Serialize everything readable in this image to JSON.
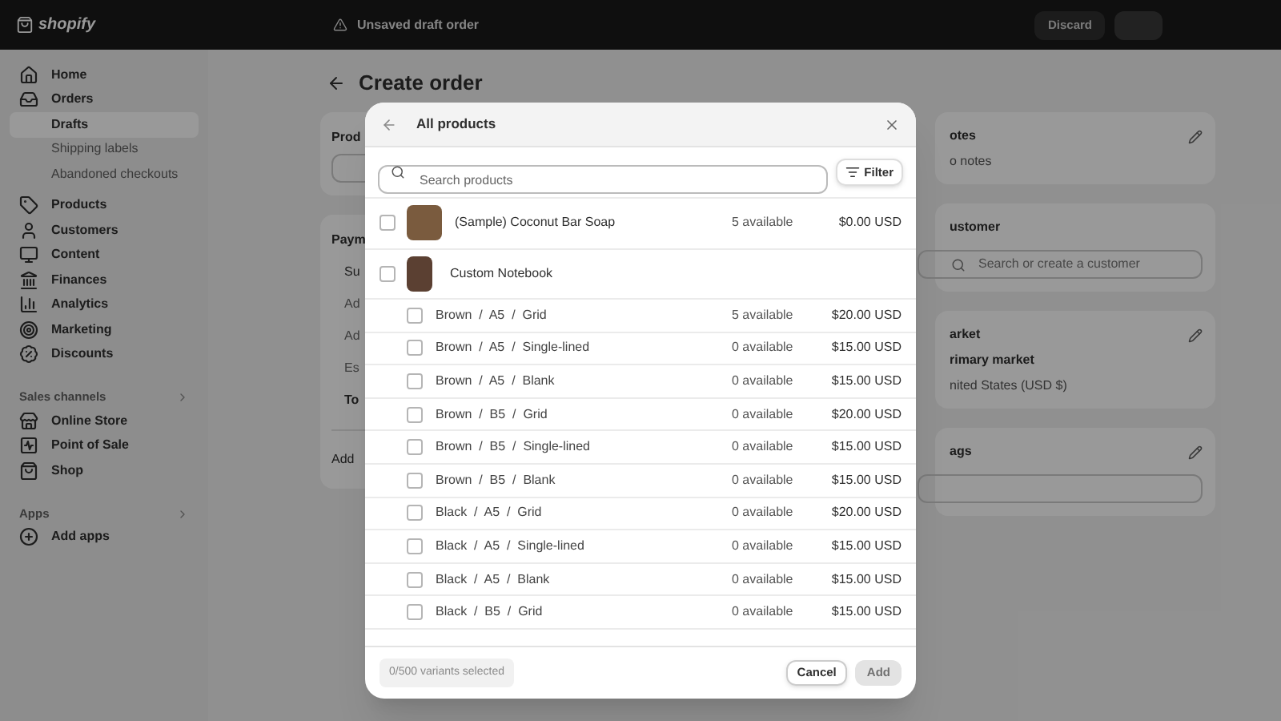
{
  "topbar": {
    "brand": "shopify",
    "notice": "Unsaved draft order",
    "buttons": [
      {
        "label": "Discard",
        "kind": "secondary"
      },
      {
        "kind": "primary"
      }
    ]
  },
  "sidebar": {
    "items": [
      {
        "label": "Home",
        "selected": false
      },
      {
        "label": "Orders",
        "selected": false,
        "children": [
          {
            "label": "Drafts",
            "selected": true
          },
          {
            "label": "Shipping labels",
            "selected": false
          },
          {
            "label": "Abandoned checkouts",
            "selected": false
          }
        ]
      },
      {
        "label": "Products",
        "selected": false
      },
      {
        "label": "Customers",
        "selected": false
      },
      {
        "label": "Content",
        "selected": false
      },
      {
        "label": "Finances",
        "selected": false
      },
      {
        "label": "Analytics",
        "selected": false
      },
      {
        "label": "Marketing",
        "selected": false
      },
      {
        "label": "Discounts",
        "selected": false
      }
    ],
    "sections": [
      {
        "title": "Sales channels",
        "items": [
          {
            "label": "Online Store"
          },
          {
            "label": "Point of Sale"
          },
          {
            "label": "Shop"
          }
        ]
      },
      {
        "title": "Apps",
        "items": [
          {
            "label": "Add apps"
          }
        ]
      }
    ]
  },
  "page": {
    "title": "Create order",
    "left_cards": [
      {
        "kind": "search",
        "title": "Prod"
      },
      {
        "kind": "summary",
        "title": "Paym",
        "lines": [
          {
            "text": "Su",
            "kind": "label"
          },
          {
            "text": "Ad",
            "kind": "muted"
          },
          {
            "text": "Ad",
            "kind": "muted"
          },
          {
            "text": "Es",
            "kind": "muted"
          },
          {
            "text": "To",
            "kind": "total"
          }
        ],
        "footer": "Add"
      }
    ],
    "right_cards": [
      {
        "kind": "notes",
        "title": "otes",
        "lines": [
          "o notes"
        ]
      },
      {
        "kind": "customer",
        "title": "ustomer",
        "placeholder": "Search or create a customer"
      },
      {
        "kind": "market",
        "title": "arket",
        "lines": [
          "rimary market",
          "nited States (USD $)"
        ]
      },
      {
        "kind": "tags",
        "title": "ags"
      }
    ]
  },
  "modal": {
    "title": "All products",
    "search": {
      "placeholder": "Search products"
    },
    "filter": "Filter",
    "rows": [
      {
        "kind": "product",
        "name": "(Sample) Coconut Bar Soap",
        "available": "5 available",
        "price": "$0.00 USD",
        "checked": false
      },
      {
        "kind": "product",
        "name": "Custom Notebook",
        "checked": false
      },
      {
        "kind": "variant",
        "name": "Brown  /  A5  /  Grid",
        "available": "5 available",
        "price": "$20.00 USD",
        "checked": false
      },
      {
        "kind": "variant",
        "name": "Brown  /  A5  /  Single-lined",
        "available": "0 available",
        "price": "$15.00 USD",
        "checked": false
      },
      {
        "kind": "variant",
        "name": "Brown  /  A5  /  Blank",
        "available": "0 available",
        "price": "$15.00 USD",
        "checked": false
      },
      {
        "kind": "variant",
        "name": "Brown  /  B5  /  Grid",
        "available": "0 available",
        "price": "$20.00 USD",
        "checked": false
      },
      {
        "kind": "variant",
        "name": "Brown  /  B5  /  Single-lined",
        "available": "0 available",
        "price": "$15.00 USD",
        "checked": false
      },
      {
        "kind": "variant",
        "name": "Brown  /  B5  /  Blank",
        "available": "0 available",
        "price": "$15.00 USD",
        "checked": false
      },
      {
        "kind": "variant",
        "name": "Black  /  A5  /  Grid",
        "available": "0 available",
        "price": "$20.00 USD",
        "checked": false
      },
      {
        "kind": "variant",
        "name": "Black  /  A5  /  Single-lined",
        "available": "0 available",
        "price": "$15.00 USD",
        "checked": false
      },
      {
        "kind": "variant",
        "name": "Black  /  A5  /  Blank",
        "available": "0 available",
        "price": "$15.00 USD",
        "checked": false
      },
      {
        "kind": "variant",
        "name": "Black  /  B5  /  Grid",
        "available": "0 available",
        "price": "$15.00 USD",
        "checked": false
      }
    ],
    "selected_count": "0/500 variants selected",
    "cancel": "Cancel",
    "add": {
      "label": "Add",
      "disabled": true
    }
  }
}
